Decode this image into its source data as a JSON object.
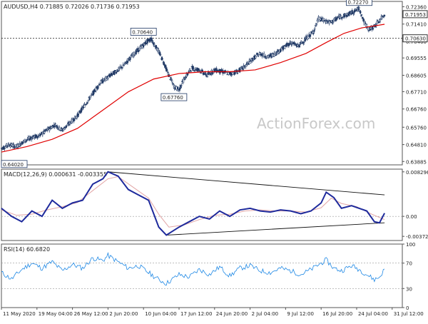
{
  "chart_data": [
    {
      "type": "candlestick",
      "symbol_header": "AUDUSD,H4  0.71885 0.72026 0.71736 0.71953",
      "watermark": "ActionForex.com",
      "y_ticks": [
        "0.72360",
        "0.71410",
        "0.70460",
        "0.69555",
        "0.68605",
        "0.67710",
        "0.66760",
        "0.65760",
        "0.64810",
        "0.63885"
      ],
      "y_tick_values": [
        0.7236,
        0.7141,
        0.7046,
        0.69555,
        0.68605,
        0.6771,
        0.6676,
        0.6576,
        0.6481,
        0.63885
      ],
      "ylim": [
        0.637,
        0.7265
      ],
      "price_series_points": [
        [
          0,
          0.646
        ],
        [
          3,
          0.648
        ],
        [
          6,
          0.647
        ],
        [
          9,
          0.65
        ],
        [
          12,
          0.652
        ],
        [
          15,
          0.653
        ],
        [
          18,
          0.656
        ],
        [
          21,
          0.659
        ],
        [
          24,
          0.656
        ],
        [
          27,
          0.66
        ],
        [
          30,
          0.664
        ],
        [
          33,
          0.67
        ],
        [
          36,
          0.676
        ],
        [
          39,
          0.682
        ],
        [
          42,
          0.685
        ],
        [
          45,
          0.688
        ],
        [
          48,
          0.691
        ],
        [
          51,
          0.696
        ],
        [
          54,
          0.7
        ],
        [
          57,
          0.704
        ],
        [
          59,
          0.706
        ],
        [
          62,
          0.699
        ],
        [
          64,
          0.693
        ],
        [
          66,
          0.686
        ],
        [
          68,
          0.68
        ],
        [
          70,
          0.678
        ],
        [
          72,
          0.684
        ],
        [
          75,
          0.69
        ],
        [
          78,
          0.689
        ],
        [
          81,
          0.686
        ],
        [
          84,
          0.689
        ],
        [
          87,
          0.688
        ],
        [
          90,
          0.687
        ],
        [
          93,
          0.688
        ],
        [
          96,
          0.691
        ],
        [
          99,
          0.695
        ],
        [
          102,
          0.698
        ],
        [
          105,
          0.696
        ],
        [
          108,
          0.698
        ],
        [
          111,
          0.701
        ],
        [
          114,
          0.704
        ],
        [
          117,
          0.702
        ],
        [
          120,
          0.706
        ],
        [
          123,
          0.71
        ],
        [
          125,
          0.717
        ],
        [
          127,
          0.716
        ],
        [
          130,
          0.715
        ],
        [
          133,
          0.718
        ],
        [
          136,
          0.719
        ],
        [
          139,
          0.721
        ],
        [
          141,
          0.7227
        ],
        [
          143,
          0.715
        ],
        [
          145,
          0.711
        ],
        [
          147,
          0.713
        ],
        [
          149,
          0.716
        ],
        [
          151,
          0.7195
        ]
      ],
      "moving_average_points": [
        [
          0,
          0.644
        ],
        [
          10,
          0.647
        ],
        [
          20,
          0.651
        ],
        [
          30,
          0.657
        ],
        [
          40,
          0.667
        ],
        [
          50,
          0.677
        ],
        [
          60,
          0.684
        ],
        [
          70,
          0.687
        ],
        [
          80,
          0.688
        ],
        [
          90,
          0.688
        ],
        [
          100,
          0.689
        ],
        [
          110,
          0.693
        ],
        [
          120,
          0.698
        ],
        [
          128,
          0.704
        ],
        [
          135,
          0.709
        ],
        [
          142,
          0.712
        ],
        [
          151,
          0.714
        ]
      ],
      "horizontal_level": 0.7063,
      "annotations": [
        {
          "label": "0.70640",
          "x": 56,
          "y": 0.7064
        },
        {
          "label": "0.67760",
          "x": 68,
          "y": 0.6776
        },
        {
          "label": "0.64020",
          "x": 1,
          "y": 0.6402
        },
        {
          "label": "0.72270",
          "x": 141,
          "y": 0.7227
        }
      ],
      "price_labels": {
        "current": "0.71953",
        "level": "0.70630"
      },
      "x_tick_labels": [
        "11 May 2020",
        "19 May 04:00",
        "26 May 12:00",
        "2 Jun 20:00",
        "10 Jun 04:00",
        "17 Jun 12:00",
        "24 Jun 20:00",
        "2 Jul 04:00",
        "9 Jul 12:00",
        "16 Jul 20:00",
        "24 Jul 04:00",
        "31 Jul 12:00"
      ],
      "x_tick_positions": [
        0,
        14,
        28,
        42,
        56,
        70,
        84,
        98,
        112,
        126,
        140,
        154
      ],
      "x_range": [
        0,
        158
      ]
    },
    {
      "type": "line",
      "title": "MACD(12,26,9) 0.000631 -0.003355",
      "y_ticks": [
        "0.008296",
        "0.00",
        "-0.003725"
      ],
      "y_tick_values": [
        0.008296,
        0.0,
        -0.003725
      ],
      "ylim": [
        -0.0045,
        0.0088
      ],
      "macd_points": [
        [
          0,
          0.0015
        ],
        [
          4,
          0.0
        ],
        [
          8,
          -0.001
        ],
        [
          12,
          0.001
        ],
        [
          16,
          0.0
        ],
        [
          20,
          0.003
        ],
        [
          24,
          0.0015
        ],
        [
          28,
          0.0025
        ],
        [
          32,
          0.003
        ],
        [
          36,
          0.006
        ],
        [
          40,
          0.007
        ],
        [
          42,
          0.0083
        ],
        [
          46,
          0.0075
        ],
        [
          50,
          0.005
        ],
        [
          54,
          0.004
        ],
        [
          58,
          0.003
        ],
        [
          62,
          -0.002
        ],
        [
          65,
          -0.0035
        ],
        [
          70,
          -0.002
        ],
        [
          74,
          -0.001
        ],
        [
          78,
          0.0
        ],
        [
          82,
          -0.0005
        ],
        [
          86,
          0.001
        ],
        [
          90,
          0.0
        ],
        [
          94,
          0.0012
        ],
        [
          98,
          0.0015
        ],
        [
          102,
          0.001
        ],
        [
          106,
          0.0008
        ],
        [
          110,
          0.0012
        ],
        [
          114,
          0.001
        ],
        [
          118,
          0.0005
        ],
        [
          122,
          0.001
        ],
        [
          126,
          0.0025
        ],
        [
          128,
          0.0045
        ],
        [
          131,
          0.0035
        ],
        [
          134,
          0.0015
        ],
        [
          138,
          0.002
        ],
        [
          141,
          0.0015
        ],
        [
          144,
          0.001
        ],
        [
          147,
          -0.001
        ],
        [
          149,
          -0.0012
        ],
        [
          151,
          0.0006
        ]
      ],
      "signal_points": [
        [
          0,
          0.0012
        ],
        [
          6,
          0.0002
        ],
        [
          12,
          0.0004
        ],
        [
          18,
          0.0012
        ],
        [
          24,
          0.0018
        ],
        [
          30,
          0.0026
        ],
        [
          36,
          0.0048
        ],
        [
          42,
          0.007
        ],
        [
          46,
          0.0074
        ],
        [
          52,
          0.0054
        ],
        [
          58,
          0.0034
        ],
        [
          62,
          0.0004
        ],
        [
          66,
          -0.002
        ],
        [
          72,
          -0.0016
        ],
        [
          78,
          -0.0006
        ],
        [
          84,
          0.0002
        ],
        [
          90,
          0.0004
        ],
        [
          96,
          0.001
        ],
        [
          102,
          0.0012
        ],
        [
          108,
          0.001
        ],
        [
          114,
          0.001
        ],
        [
          120,
          0.0008
        ],
        [
          126,
          0.0016
        ],
        [
          130,
          0.0034
        ],
        [
          134,
          0.0024
        ],
        [
          140,
          0.0018
        ],
        [
          146,
          0.0004
        ],
        [
          151,
          -0.0006
        ]
      ],
      "trend_lines": [
        [
          [
            42,
            0.0083
          ],
          [
            151,
            0.004
          ]
        ],
        [
          [
            65,
            -0.0035
          ],
          [
            151,
            -0.0012
          ]
        ]
      ],
      "x_range": [
        0,
        158
      ]
    },
    {
      "type": "line",
      "title": "RSI(14) 60.6820",
      "y_ticks": [
        "100",
        "70",
        "30",
        "0"
      ],
      "y_tick_values": [
        100,
        70,
        30,
        0
      ],
      "ylim": [
        0,
        100
      ],
      "dashed_levels": [
        70,
        30
      ],
      "rsi_points": [
        [
          0,
          55
        ],
        [
          4,
          45
        ],
        [
          8,
          60
        ],
        [
          12,
          70
        ],
        [
          16,
          62
        ],
        [
          20,
          72
        ],
        [
          24,
          58
        ],
        [
          28,
          68
        ],
        [
          32,
          62
        ],
        [
          36,
          78
        ],
        [
          40,
          74
        ],
        [
          42,
          82
        ],
        [
          46,
          72
        ],
        [
          50,
          62
        ],
        [
          54,
          66
        ],
        [
          58,
          55
        ],
        [
          62,
          44
        ],
        [
          65,
          38
        ],
        [
          70,
          52
        ],
        [
          74,
          48
        ],
        [
          78,
          60
        ],
        [
          82,
          52
        ],
        [
          86,
          64
        ],
        [
          90,
          50
        ],
        [
          94,
          62
        ],
        [
          98,
          66
        ],
        [
          102,
          58
        ],
        [
          106,
          55
        ],
        [
          110,
          62
        ],
        [
          114,
          58
        ],
        [
          118,
          52
        ],
        [
          122,
          60
        ],
        [
          126,
          70
        ],
        [
          128,
          75
        ],
        [
          131,
          62
        ],
        [
          134,
          58
        ],
        [
          138,
          66
        ],
        [
          141,
          60
        ],
        [
          144,
          52
        ],
        [
          147,
          44
        ],
        [
          149,
          48
        ],
        [
          151,
          60.68
        ]
      ],
      "x_range": [
        0,
        158
      ]
    }
  ],
  "colors": {
    "candle": "#1f3864",
    "moving_average": "#e00000",
    "macd_line": "#1e2a9c",
    "signal_line": "#e2a6a6",
    "rsi_line": "#1e88e5",
    "grid_text": "#222222",
    "label_fill": "#ffffff",
    "label_border": "#1f3864"
  }
}
